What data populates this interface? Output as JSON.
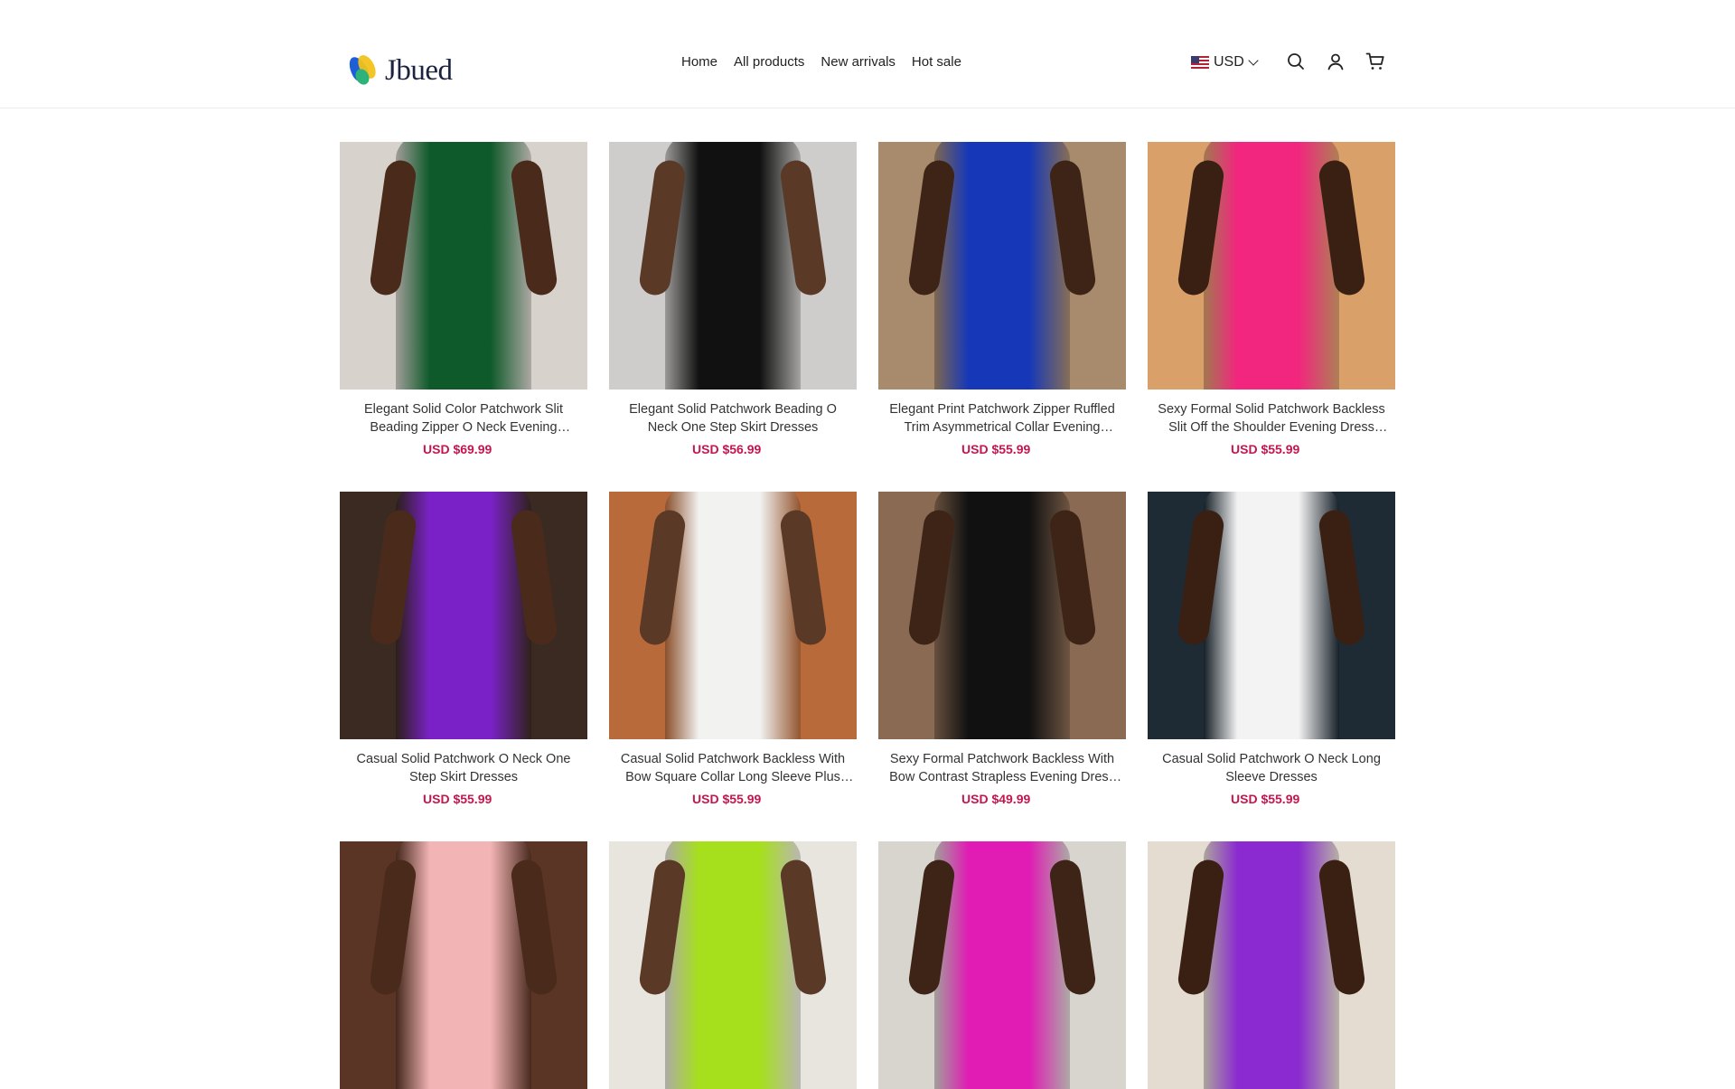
{
  "brand": {
    "name": "Jbued"
  },
  "nav": {
    "items": [
      "Home",
      "All products",
      "New arrivals",
      "Hot sale"
    ]
  },
  "currency": {
    "label": "USD"
  },
  "icons": {
    "search": "search-icon",
    "account": "user-icon",
    "cart": "cart-icon"
  },
  "colors": {
    "price": "#c4164e",
    "text": "#333333"
  },
  "products": [
    {
      "title": "Elegant Solid Color Patchwork Slit Beading Zipper O Neck Evening Dresses",
      "price": "USD $69.99",
      "bg": "#d7d2cc",
      "dress": "#0f5a2a",
      "skin": "#4a2a1a"
    },
    {
      "title": "Elegant Solid Patchwork Beading O Neck One Step Skirt Dresses",
      "price": "USD $56.99",
      "bg": "#cfcdcb",
      "dress": "#111111",
      "skin": "#5a3a26"
    },
    {
      "title": "Elegant Print Patchwork Zipper Ruffled Trim Asymmetrical Collar Evening Dresses",
      "price": "USD $55.99",
      "bg": "#a88a6c",
      "dress": "#1638b8",
      "skin": "#3e2416"
    },
    {
      "title": "Sexy Formal Solid Patchwork Backless Slit Off the Shoulder Evening Dress Dresses",
      "price": "USD $55.99",
      "bg": "#d9a06a",
      "dress": "#f2267e",
      "skin": "#3a2013"
    },
    {
      "title": "Casual Solid Patchwork O Neck One Step Skirt Dresses",
      "price": "USD $55.99",
      "bg": "#3a2a22",
      "dress": "#7a22c7",
      "skin": "#4a2a1a"
    },
    {
      "title": "Casual Solid Patchwork Backless With Bow Square Collar Long Sleeve Plus Size Dresses",
      "price": "USD $55.99",
      "bg": "#b86a3a",
      "dress": "#f2f2f0",
      "skin": "#5a3a26"
    },
    {
      "title": "Sexy Formal Patchwork Backless With Bow Contrast Strapless Evening Dress Dresses",
      "price": "USD $49.99",
      "bg": "#8a6a52",
      "dress": "#111111",
      "skin": "#3e2416"
    },
    {
      "title": "Casual Solid Patchwork O Neck Long Sleeve Dresses",
      "price": "USD $55.99",
      "bg": "#1e2a34",
      "dress": "#f3f3f3",
      "skin": "#3a2013"
    },
    {
      "title": "",
      "price": "",
      "bg": "#5a3424",
      "dress": "#f2b4b4",
      "skin": "#4a2a1a"
    },
    {
      "title": "",
      "price": "",
      "bg": "#e8e4de",
      "dress": "#a6e01c",
      "skin": "#5a3a26"
    },
    {
      "title": "",
      "price": "",
      "bg": "#d8d4ce",
      "dress": "#e01cb4",
      "skin": "#3e2416"
    },
    {
      "title": "",
      "price": "",
      "bg": "#e4dcd0",
      "dress": "#8a2ad0",
      "skin": "#3a2013"
    }
  ]
}
